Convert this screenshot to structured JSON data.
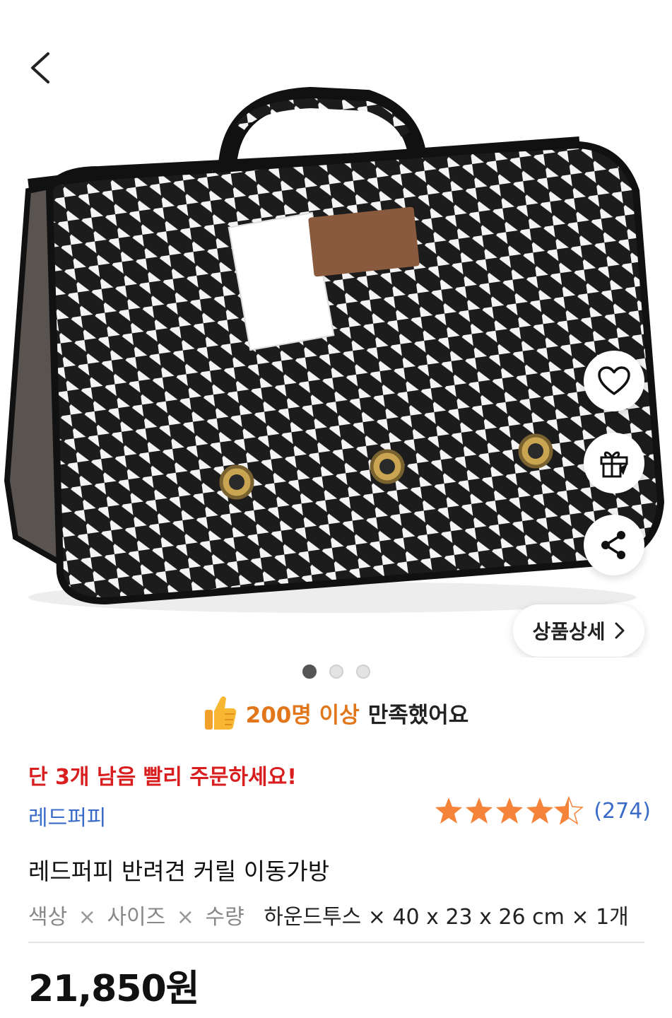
{
  "nav": {
    "back_icon": "chevron-left-icon"
  },
  "actions": {
    "wishlist_icon": "heart-icon",
    "gift_icon": "gift-icon",
    "share_icon": "share-icon",
    "detail_label": "상품상세"
  },
  "gallery": {
    "total": 3,
    "active_index": 0
  },
  "satisfaction": {
    "icon": "thumbs-up-icon",
    "highlight": "200명 이상",
    "text": "만족했어요"
  },
  "stock_notice": "단 3개 남음 빨리 주문하세요!",
  "brand": "레드퍼피",
  "rating": {
    "stars": 4.5,
    "count_text": "(274)"
  },
  "product": {
    "title": "레드퍼피 반려견 커릴 이동가방",
    "option_labels": [
      "색상",
      "사이즈",
      "수량"
    ],
    "option_value": "하운드투스 × 40 x 23 x 26 cm × 1개"
  },
  "price": "21,850원",
  "colors": {
    "accent_orange": "#e2761b",
    "alert_red": "#d81e1e",
    "link_blue": "#3a6bc9",
    "star": "#f5843a"
  }
}
